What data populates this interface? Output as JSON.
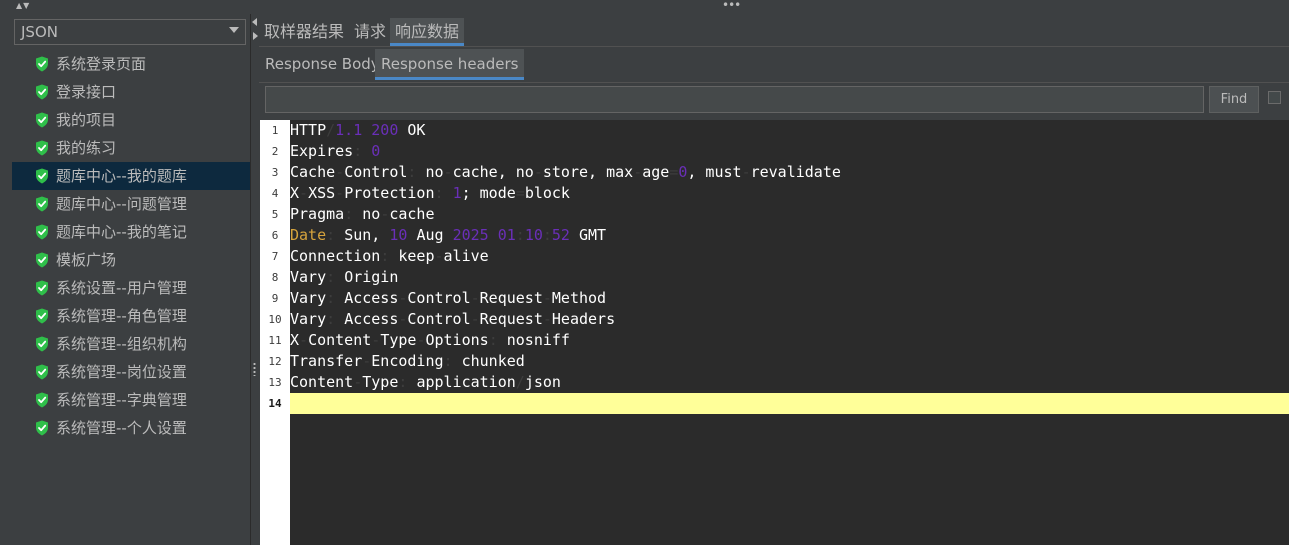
{
  "renderer_select": {
    "value": "JSON"
  },
  "tree": {
    "items": [
      {
        "label": "系统登录页面",
        "selected": false
      },
      {
        "label": "登录接口",
        "selected": false
      },
      {
        "label": "我的项目",
        "selected": false
      },
      {
        "label": "我的练习",
        "selected": false
      },
      {
        "label": "题库中心--我的题库",
        "selected": true
      },
      {
        "label": "题库中心--问题管理",
        "selected": false
      },
      {
        "label": "题库中心--我的笔记",
        "selected": false
      },
      {
        "label": "模板广场",
        "selected": false
      },
      {
        "label": "系统设置--用户管理",
        "selected": false
      },
      {
        "label": "系统管理--角色管理",
        "selected": false
      },
      {
        "label": "系统管理--组织机构",
        "selected": false
      },
      {
        "label": "系统管理--岗位设置",
        "selected": false
      },
      {
        "label": "系统管理--字典管理",
        "selected": false
      },
      {
        "label": "系统管理--个人设置",
        "selected": false
      }
    ]
  },
  "tabs": [
    {
      "label": "取样器结果",
      "active": false
    },
    {
      "label": "请求",
      "active": false
    },
    {
      "label": "响应数据",
      "active": true
    }
  ],
  "subtabs": [
    {
      "label": "Response Body",
      "active": false
    },
    {
      "label": "Response headers",
      "active": true
    }
  ],
  "search": {
    "value": "",
    "find_label": "Find",
    "checkbox_checked": false
  },
  "editor": {
    "current_line": 14,
    "lines": [
      [
        [
          "key",
          "HTTP"
        ],
        [
          "punc",
          "/"
        ],
        [
          "num",
          "1.1"
        ],
        [
          "punc",
          " "
        ],
        [
          "num",
          "200"
        ],
        [
          "punc",
          " "
        ],
        [
          "text",
          "OK"
        ]
      ],
      [
        [
          "key",
          "Expires"
        ],
        [
          "punc",
          ": "
        ],
        [
          "num",
          "0"
        ]
      ],
      [
        [
          "key",
          "Cache"
        ],
        [
          "punc",
          "-"
        ],
        [
          "key",
          "Control"
        ],
        [
          "punc",
          ": "
        ],
        [
          "text",
          "no"
        ],
        [
          "punc",
          "-"
        ],
        [
          "text",
          "cache, no"
        ],
        [
          "punc",
          "-"
        ],
        [
          "text",
          "store, max"
        ],
        [
          "punc",
          "-"
        ],
        [
          "text",
          "age"
        ],
        [
          "punc",
          "="
        ],
        [
          "num",
          "0"
        ],
        [
          "text",
          ", must"
        ],
        [
          "punc",
          "-"
        ],
        [
          "text",
          "revalidate"
        ]
      ],
      [
        [
          "key",
          "X"
        ],
        [
          "punc",
          "-"
        ],
        [
          "key",
          "XSS"
        ],
        [
          "punc",
          "-"
        ],
        [
          "key",
          "Protection"
        ],
        [
          "punc",
          ": "
        ],
        [
          "num",
          "1"
        ],
        [
          "text",
          "; mode"
        ],
        [
          "punc",
          "="
        ],
        [
          "text",
          "block"
        ]
      ],
      [
        [
          "key",
          "Pragma"
        ],
        [
          "punc",
          ": "
        ],
        [
          "text",
          "no"
        ],
        [
          "punc",
          "-"
        ],
        [
          "text",
          "cache"
        ]
      ],
      [
        [
          "date",
          "Date"
        ],
        [
          "punc",
          ": "
        ],
        [
          "text",
          "Sun, "
        ],
        [
          "num",
          "10"
        ],
        [
          "punc",
          " "
        ],
        [
          "text",
          "Aug"
        ],
        [
          "punc",
          " "
        ],
        [
          "num",
          "2025"
        ],
        [
          "punc",
          " "
        ],
        [
          "num",
          "01"
        ],
        [
          "punc",
          ":"
        ],
        [
          "num",
          "10"
        ],
        [
          "punc",
          ":"
        ],
        [
          "num",
          "52"
        ],
        [
          "punc",
          " "
        ],
        [
          "text",
          "GMT"
        ]
      ],
      [
        [
          "key",
          "Connection"
        ],
        [
          "punc",
          ": "
        ],
        [
          "text",
          "keep"
        ],
        [
          "punc",
          "-"
        ],
        [
          "text",
          "alive"
        ]
      ],
      [
        [
          "key",
          "Vary"
        ],
        [
          "punc",
          ": "
        ],
        [
          "text",
          "Origin"
        ]
      ],
      [
        [
          "key",
          "Vary"
        ],
        [
          "punc",
          ": "
        ],
        [
          "text",
          "Access"
        ],
        [
          "punc",
          "-"
        ],
        [
          "text",
          "Control"
        ],
        [
          "punc",
          "-"
        ],
        [
          "text",
          "Request"
        ],
        [
          "punc",
          "-"
        ],
        [
          "text",
          "Method"
        ]
      ],
      [
        [
          "key",
          "Vary"
        ],
        [
          "punc",
          ": "
        ],
        [
          "text",
          "Access"
        ],
        [
          "punc",
          "-"
        ],
        [
          "text",
          "Control"
        ],
        [
          "punc",
          "-"
        ],
        [
          "text",
          "Request"
        ],
        [
          "punc",
          "-"
        ],
        [
          "text",
          "Headers"
        ]
      ],
      [
        [
          "key",
          "X"
        ],
        [
          "punc",
          "-"
        ],
        [
          "key",
          "Content"
        ],
        [
          "punc",
          "-"
        ],
        [
          "key",
          "Type"
        ],
        [
          "punc",
          "-"
        ],
        [
          "key",
          "Options"
        ],
        [
          "punc",
          ": "
        ],
        [
          "text",
          "nosniff"
        ]
      ],
      [
        [
          "key",
          "Transfer"
        ],
        [
          "punc",
          "-"
        ],
        [
          "key",
          "Encoding"
        ],
        [
          "punc",
          ": "
        ],
        [
          "text",
          "chunked"
        ]
      ],
      [
        [
          "key",
          "Content"
        ],
        [
          "punc",
          "-"
        ],
        [
          "key",
          "Type"
        ],
        [
          "punc",
          ": "
        ],
        [
          "text",
          "application"
        ],
        [
          "punc",
          "/"
        ],
        [
          "text",
          "json"
        ]
      ],
      []
    ]
  },
  "colors": {
    "background": "#3c3f41",
    "selection": "#0d293e",
    "accent": "#4a88c7",
    "shield": "#2fbf4a",
    "current_line": "#ffff99",
    "number_token": "#6a2fb8",
    "date_token": "#d6a33c"
  },
  "icons": {
    "tree_item": "shield-check-icon",
    "splitter_arrows": "triangle-arrows-icon"
  }
}
